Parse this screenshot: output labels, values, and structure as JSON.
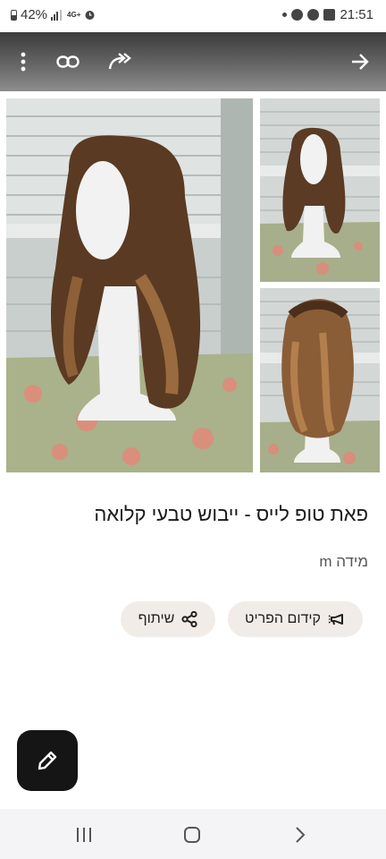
{
  "status_bar": {
    "battery_text": "42%",
    "network_text": "4G+",
    "time": "21:51"
  },
  "toolbar": {
    "icons": [
      "more-vert-icon",
      "link-icon",
      "share-arrow-icon",
      "forward-arrow-icon"
    ]
  },
  "gallery": {
    "images": [
      "wig-front-photo",
      "wig-front-photo-small",
      "wig-back-photo"
    ]
  },
  "product": {
    "title": "פאת טופ לייס - ייבוש טבעי קלואה",
    "size_label": "מידה m"
  },
  "actions": {
    "promote_label": "קידום הפריט",
    "share_label": "שיתוף"
  },
  "fab": {
    "icon": "pencil-icon"
  },
  "colors": {
    "chip_background": "#f2ece8",
    "fab_background": "#151515",
    "toolbar_gradient_top": "#3b3b3b",
    "nav_background": "#f4f4f6"
  }
}
